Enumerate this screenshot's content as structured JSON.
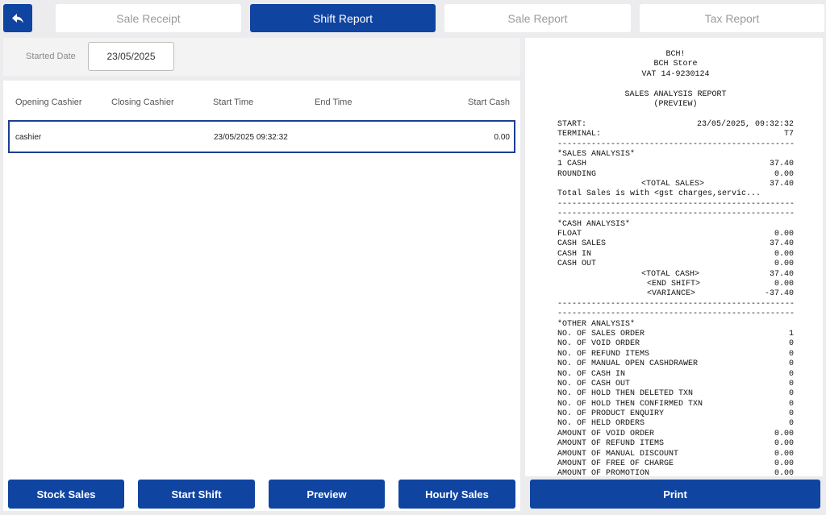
{
  "nav": {
    "back_icon": "back-arrow-icon",
    "tabs": [
      {
        "label": "Sale Receipt",
        "active": false
      },
      {
        "label": "Shift Report",
        "active": true
      },
      {
        "label": "Sale Report",
        "active": false
      },
      {
        "label": "Tax Report",
        "active": false
      }
    ]
  },
  "filter": {
    "label": "Started Date",
    "value": "23/05/2025"
  },
  "table": {
    "headers": [
      "Opening Cashier",
      "Closing Cashier",
      "Start Time",
      "End Time",
      "Start Cash"
    ],
    "rows": [
      {
        "opening": "cashier",
        "closing": "",
        "start": "23/05/2025 09:32:32",
        "end": "",
        "cash": "0.00"
      }
    ]
  },
  "buttons": {
    "stock_sales": "Stock Sales",
    "start_shift": "Start Shift",
    "preview": "Preview",
    "hourly_sales": "Hourly Sales",
    "print": "Print"
  },
  "receipt": {
    "header": [
      "BCH!",
      "BCH Store",
      "VAT 14-9230124"
    ],
    "title": "SALES ANALYSIS REPORT",
    "subtitle": "(PREVIEW)",
    "start_label": "START:",
    "start_value": "23/05/2025, 09:32:32",
    "terminal_label": "TERMINAL:",
    "terminal_value": "T7",
    "dashes": "----------------------------------------------------",
    "sales_title": "*SALES ANALYSIS*",
    "sales": [
      {
        "label": "1 CASH",
        "value": "37.40"
      },
      {
        "label": "ROUNDING",
        "value": "0.00"
      }
    ],
    "total_sales_label": "<TOTAL SALES>",
    "total_sales_value": "37.40",
    "gst_note": "Total Sales is with <gst charges,servic...",
    "cash_title": "*CASH ANALYSIS*",
    "cash": [
      {
        "label": "FLOAT",
        "value": "0.00"
      },
      {
        "label": "CASH SALES",
        "value": "37.40"
      },
      {
        "label": "CASH IN",
        "value": "0.00"
      },
      {
        "label": "CASH OUT",
        "value": "0.00"
      }
    ],
    "cash_totals": [
      {
        "label": "<TOTAL CASH>",
        "value": "37.40"
      },
      {
        "label": "<END SHIFT>",
        "value": "0.00"
      },
      {
        "label": "<VARIANCE>",
        "value": "-37.40"
      }
    ],
    "other_title": "*OTHER ANALYSIS*",
    "other": [
      {
        "label": "NO. OF SALES ORDER",
        "value": "1"
      },
      {
        "label": "NO. OF VOID ORDER",
        "value": "0"
      },
      {
        "label": "NO. OF REFUND ITEMS",
        "value": "0"
      },
      {
        "label": "NO. OF MANUAL OPEN CASHDRAWER",
        "value": "0"
      },
      {
        "label": "NO. OF CASH IN",
        "value": "0"
      },
      {
        "label": "NO. OF CASH OUT",
        "value": "0"
      },
      {
        "label": "NO. OF HOLD THEN DELETED TXN",
        "value": "0"
      },
      {
        "label": "NO. OF HOLD THEN CONFIRMED TXN",
        "value": "0"
      },
      {
        "label": "NO. OF PRODUCT ENQUIRY",
        "value": "0"
      },
      {
        "label": "NO. OF HELD ORDERS",
        "value": "0"
      },
      {
        "label": "AMOUNT OF VOID ORDER",
        "value": "0.00"
      },
      {
        "label": "AMOUNT OF REFUND ITEMS",
        "value": "0.00"
      },
      {
        "label": "AMOUNT OF MANUAL DISCOUNT",
        "value": "0.00"
      },
      {
        "label": "AMOUNT OF FREE OF CHARGE",
        "value": "0.00"
      },
      {
        "label": "AMOUNT OF PROMOTION",
        "value": "0.00"
      }
    ]
  },
  "colors": {
    "primary": "#1044a1",
    "background": "#ececef"
  }
}
